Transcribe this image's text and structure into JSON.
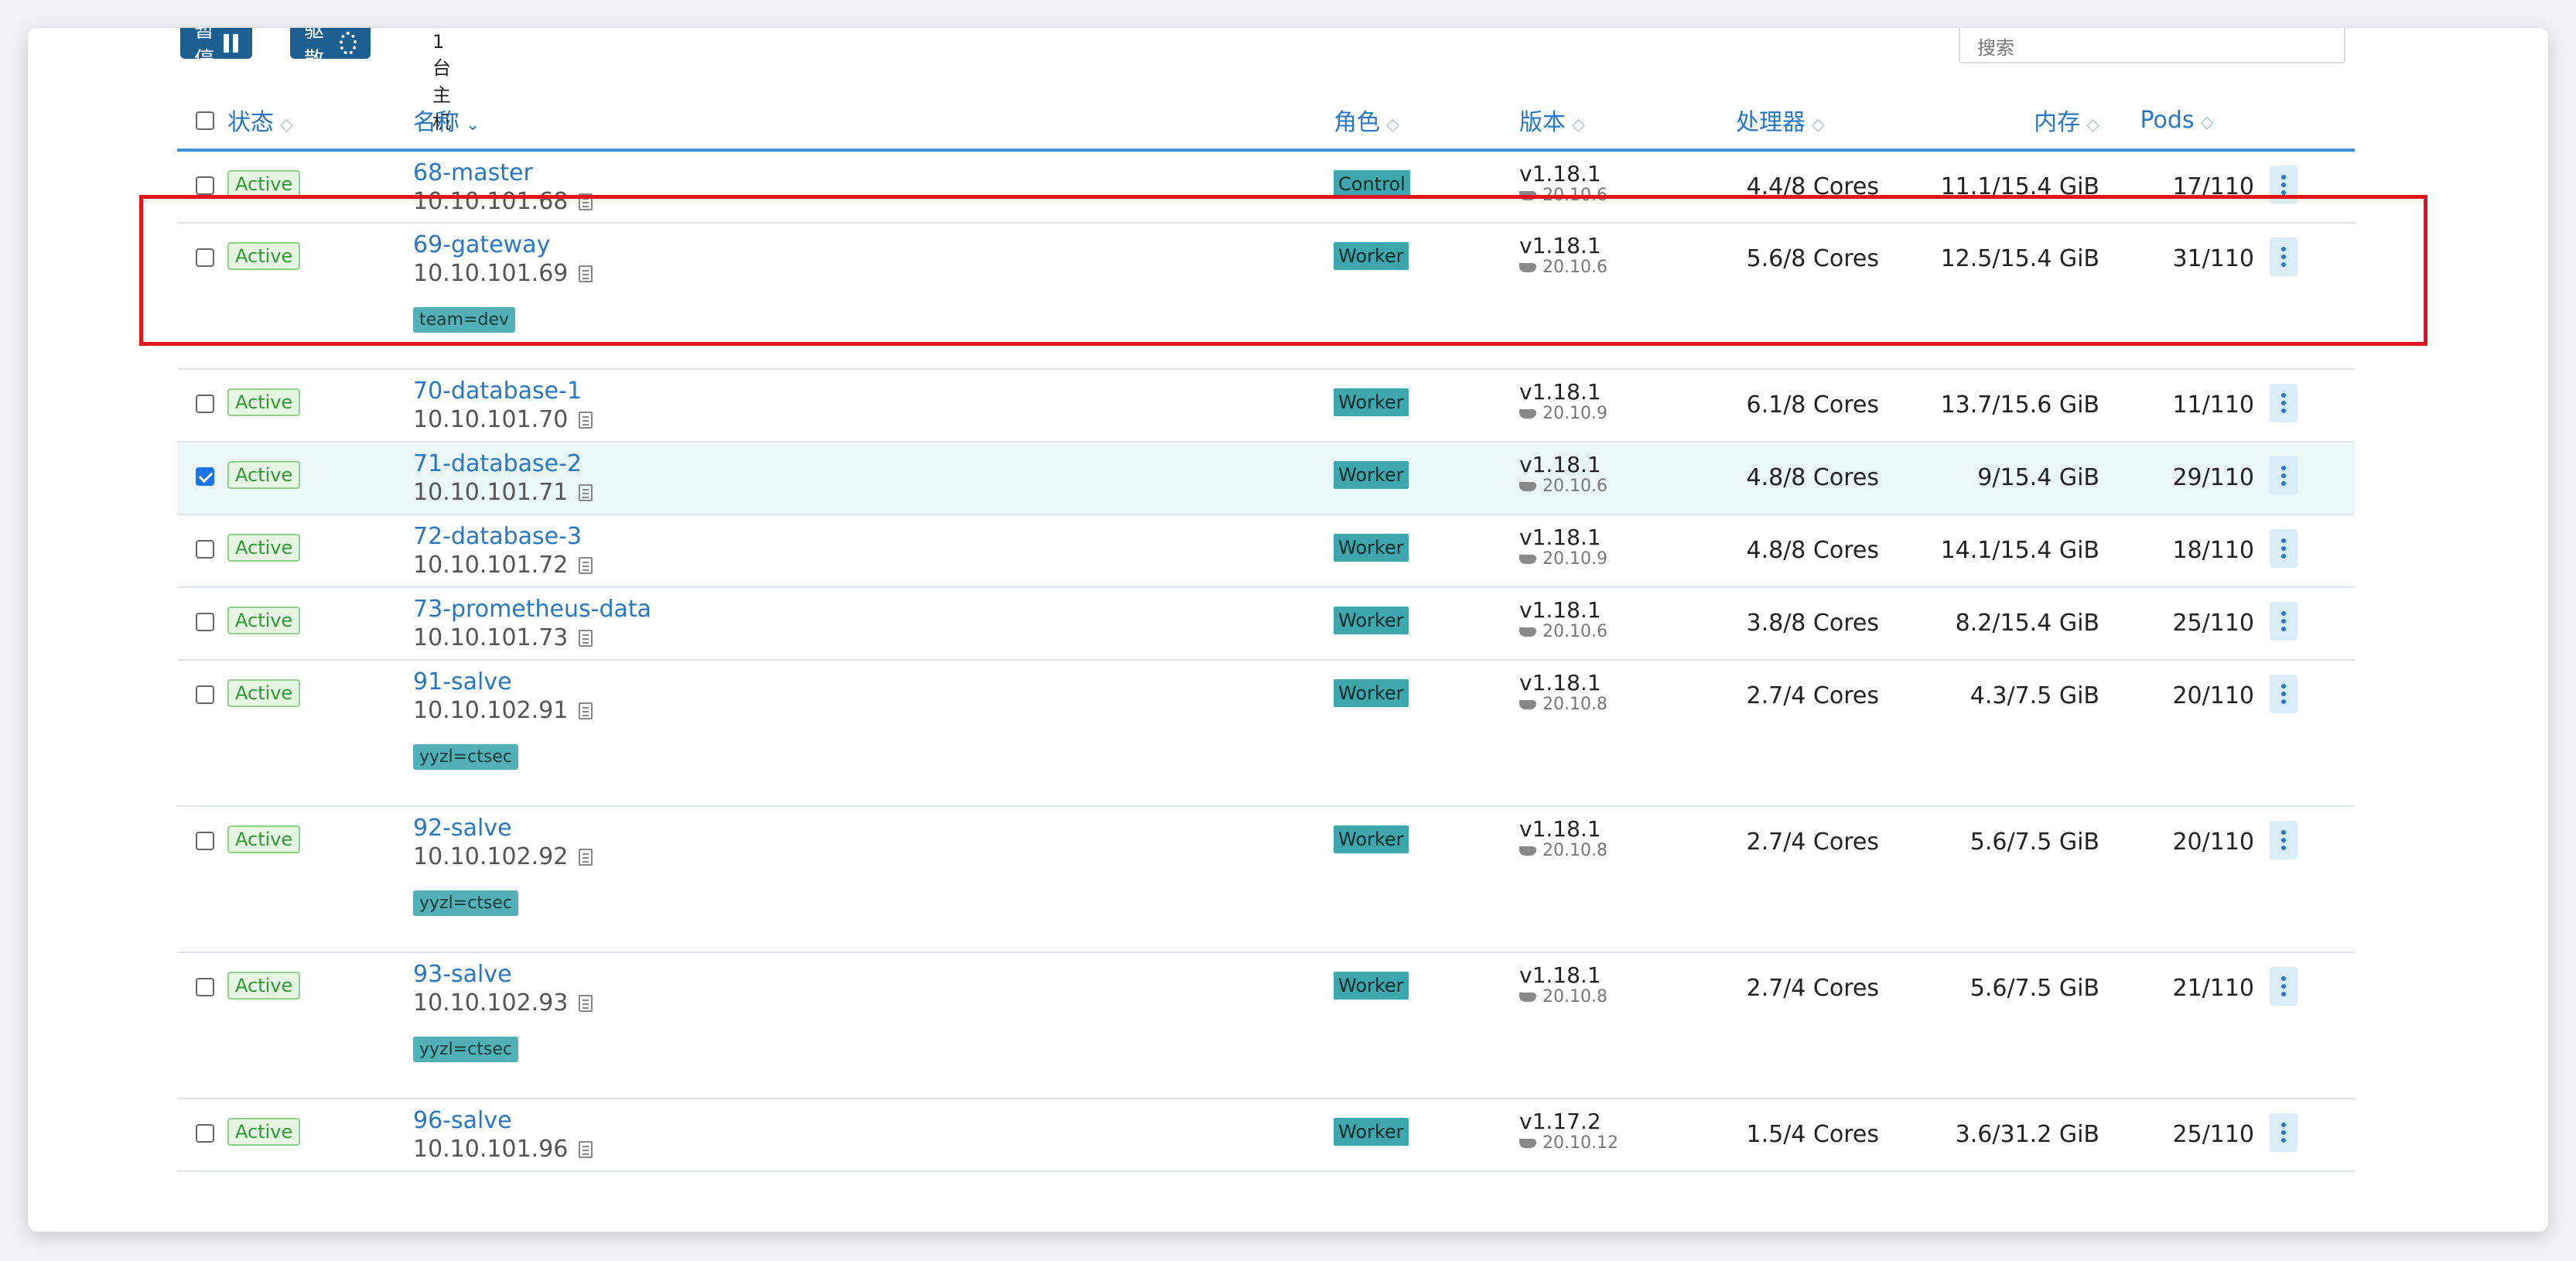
{
  "toolbar": {
    "pause_label": "暂停",
    "drain_label": "驱散",
    "host_count": "1台主机",
    "search_placeholder": "搜索"
  },
  "columns": {
    "status": "状态",
    "name": "名称",
    "role": "角色",
    "version": "版本",
    "cpu": "处理器",
    "memory": "内存",
    "pods": "Pods"
  },
  "rows": [
    {
      "checked": false,
      "status": "Active",
      "name": "68-master",
      "ip": "10.10.101.68",
      "tag": "",
      "role": "Control",
      "kube": "v1.18.1",
      "docker": "20.10.6",
      "cpu": "4.4/8 Cores",
      "memory": "11.1/15.4 GiB",
      "pods": "17/110"
    },
    {
      "checked": false,
      "status": "Active",
      "name": "69-gateway",
      "ip": "10.10.101.69",
      "tag": "team=dev",
      "role": "Worker",
      "kube": "v1.18.1",
      "docker": "20.10.6",
      "cpu": "5.6/8 Cores",
      "memory": "12.5/15.4 GiB",
      "pods": "31/110"
    },
    {
      "checked": false,
      "status": "Active",
      "name": "70-database-1",
      "ip": "10.10.101.70",
      "tag": "",
      "role": "Worker",
      "kube": "v1.18.1",
      "docker": "20.10.9",
      "cpu": "6.1/8 Cores",
      "memory": "13.7/15.6 GiB",
      "pods": "11/110"
    },
    {
      "checked": true,
      "status": "Active",
      "name": "71-database-2",
      "ip": "10.10.101.71",
      "tag": "",
      "role": "Worker",
      "kube": "v1.18.1",
      "docker": "20.10.6",
      "cpu": "4.8/8 Cores",
      "memory": "9/15.4 GiB",
      "pods": "29/110"
    },
    {
      "checked": false,
      "status": "Active",
      "name": "72-database-3",
      "ip": "10.10.101.72",
      "tag": "",
      "role": "Worker",
      "kube": "v1.18.1",
      "docker": "20.10.9",
      "cpu": "4.8/8 Cores",
      "memory": "14.1/15.4 GiB",
      "pods": "18/110"
    },
    {
      "checked": false,
      "status": "Active",
      "name": "73-prometheus-data",
      "ip": "10.10.101.73",
      "tag": "",
      "role": "Worker",
      "kube": "v1.18.1",
      "docker": "20.10.6",
      "cpu": "3.8/8 Cores",
      "memory": "8.2/15.4 GiB",
      "pods": "25/110"
    },
    {
      "checked": false,
      "status": "Active",
      "name": "91-salve",
      "ip": "10.10.102.91",
      "tag": "yyzl=ctsec",
      "role": "Worker",
      "kube": "v1.18.1",
      "docker": "20.10.8",
      "cpu": "2.7/4 Cores",
      "memory": "4.3/7.5 GiB",
      "pods": "20/110"
    },
    {
      "checked": false,
      "status": "Active",
      "name": "92-salve",
      "ip": "10.10.102.92",
      "tag": "yyzl=ctsec",
      "role": "Worker",
      "kube": "v1.18.1",
      "docker": "20.10.8",
      "cpu": "2.7/4 Cores",
      "memory": "5.6/7.5 GiB",
      "pods": "20/110"
    },
    {
      "checked": false,
      "status": "Active",
      "name": "93-salve",
      "ip": "10.10.102.93",
      "tag": "yyzl=ctsec",
      "role": "Worker",
      "kube": "v1.18.1",
      "docker": "20.10.8",
      "cpu": "2.7/4 Cores",
      "memory": "5.6/7.5 GiB",
      "pods": "21/110"
    },
    {
      "checked": false,
      "status": "Active",
      "name": "96-salve",
      "ip": "10.10.101.96",
      "tag": "",
      "role": "Worker",
      "kube": "v1.17.2",
      "docker": "20.10.12",
      "cpu": "1.5/4 Cores",
      "memory": "3.6/31.2 GiB",
      "pods": "25/110"
    }
  ],
  "colors": {
    "link": "#2777c5",
    "status_green": "#2d9b33",
    "role_teal": "#3ea7ad",
    "highlight_red": "#e0161c"
  }
}
